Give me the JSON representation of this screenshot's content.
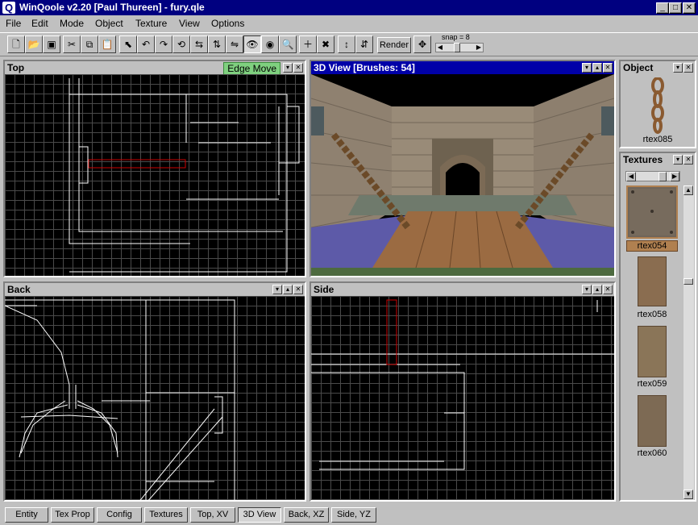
{
  "window": {
    "app_letter": "Q",
    "title": "WinQoole v2.20 [Paul Thureen] - fury.qle"
  },
  "menu": [
    "File",
    "Edit",
    "Mode",
    "Object",
    "Texture",
    "View",
    "Options"
  ],
  "toolbar": {
    "render_label": "Render",
    "snap_label": "snap = 8"
  },
  "panes": {
    "top": {
      "title": "Top",
      "mode_badge": "Edge Move"
    },
    "view3d": {
      "title": "3D View  [Brushes: 54]"
    },
    "back": {
      "title": "Back"
    },
    "side": {
      "title": "Side"
    }
  },
  "object_panel": {
    "title": "Object",
    "name": "rtex085"
  },
  "textures_panel": {
    "title": "Textures",
    "items": [
      "rtex054",
      "rtex058",
      "rtex059",
      "rtex060"
    ],
    "selected": "rtex054"
  },
  "tabs": [
    "Entity",
    "Tex Prop",
    "Config",
    "Textures",
    "Top, XV",
    "3D View",
    "Back, XZ",
    "Side, YZ"
  ],
  "colors": {
    "title_bar": "#000080",
    "active_pane": "#0000a8",
    "grid_bg": "#000000",
    "grid_line": "#4a4a4a",
    "brush_line": "#ffffff",
    "selected_brush": "#cc0000",
    "edge_move_badge": "#7fd07f",
    "selected_texture": "#b08050"
  }
}
